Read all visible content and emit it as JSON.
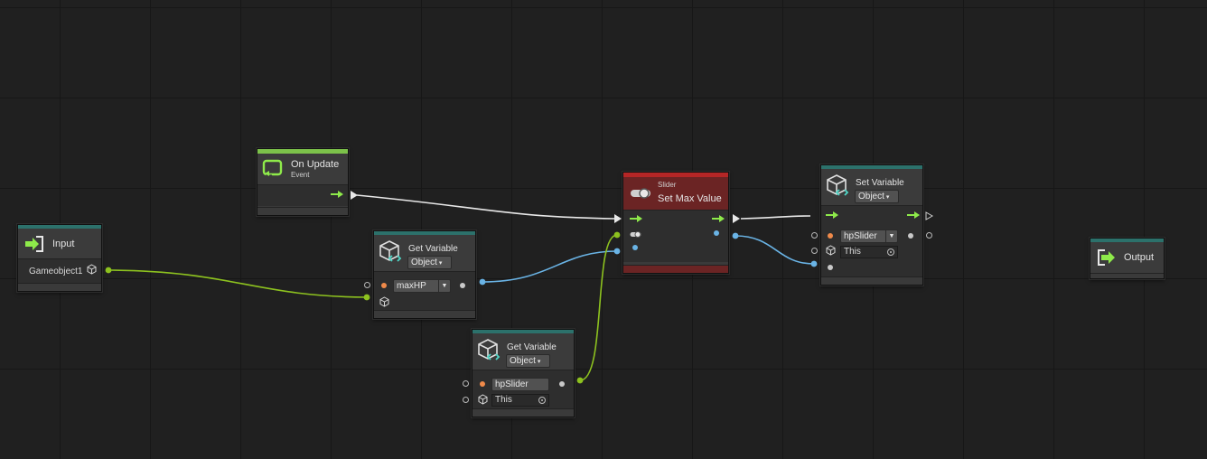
{
  "nodes": {
    "on_update": {
      "title": "On Update",
      "subtitle": "Event"
    },
    "input": {
      "title": "Input",
      "port_label": "Gameobject1"
    },
    "get_var_maxhp": {
      "title": "Get Variable",
      "type_value": "Object",
      "var_name": "maxHP"
    },
    "get_var_hpslider": {
      "title": "Get Variable",
      "type_value": "Object",
      "var_name": "hpSlider",
      "target_value": "This"
    },
    "slider_set_max": {
      "category": "Slider",
      "title": "Set Max Value"
    },
    "set_variable": {
      "title": "Set Variable",
      "type_value": "Object",
      "var_name": "hpSlider",
      "target_value": "This"
    },
    "output": {
      "title": "Output"
    }
  },
  "colors": {
    "teal": "#2c716b",
    "event_green": "#7cc24a",
    "unit_red": "#b52626",
    "wire_white": "#e8e8e8",
    "wire_blue": "#6ab4e6",
    "wire_lime": "#8dc21f",
    "flow_arrow": "#8eea4a",
    "port_orange": "#f08a4a"
  },
  "icons": {
    "event": "loop-arrow-icon",
    "input": "enter-arrow-icon",
    "output": "exit-arrow-icon",
    "variable": "cube-code-icon",
    "slider": "toggle-slider-icon"
  }
}
